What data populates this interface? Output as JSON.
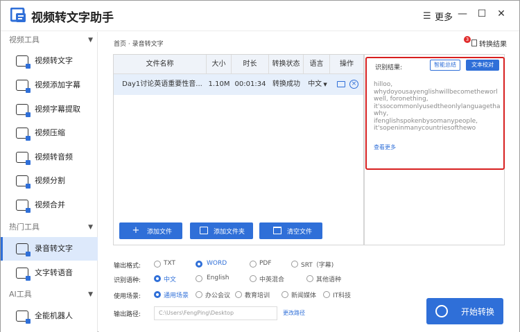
{
  "app": {
    "title": "视频转文字助手",
    "more_label": "更多",
    "menu_glyph": "☰",
    "minimize_glyph": "—",
    "maximize_glyph": "☐",
    "close_glyph": "✕"
  },
  "sidebar": {
    "sections": [
      {
        "label": "视频工具",
        "caret": "▼"
      },
      {
        "label": "热门工具",
        "caret": "▼"
      },
      {
        "label": "AI工具",
        "caret": "▼"
      }
    ],
    "video_tools": [
      {
        "label": "视频转文字",
        "icon": "video-to-text-icon"
      },
      {
        "label": "视频添加字幕",
        "icon": "add-subtitle-icon"
      },
      {
        "label": "视频字幕提取",
        "icon": "subtitle-extract-icon"
      },
      {
        "label": "视频压缩",
        "icon": "compress-icon"
      },
      {
        "label": "视频转音频",
        "icon": "video-to-audio-icon"
      },
      {
        "label": "视频分割",
        "icon": "split-icon"
      },
      {
        "label": "视频合并",
        "icon": "merge-icon"
      }
    ],
    "hot_tools": [
      {
        "label": "录音转文字",
        "icon": "audio-to-text-icon",
        "active": true
      },
      {
        "label": "文字转语音",
        "icon": "text-to-speech-icon"
      }
    ],
    "ai_tools": [
      {
        "label": "全能机器人",
        "icon": "robot-icon"
      }
    ]
  },
  "breadcrumb": "首页 · 录音转文字",
  "result_link": {
    "badge": "3",
    "label": "转换结果"
  },
  "table": {
    "headers": [
      "文件名称",
      "大小",
      "时长",
      "转换状态",
      "语言",
      "操作"
    ],
    "rows": [
      {
        "name": "Day1讨论英语重要性音...",
        "size": "1.10M",
        "duration": "00:01:34",
        "status": "转换成功",
        "language": "中文"
      }
    ]
  },
  "file_buttons": {
    "add_file": "添加文件",
    "add_folder": "添加文件夹",
    "clear": "清空文件"
  },
  "recognition": {
    "label": "识别结果:",
    "summary_button": "智能总结",
    "proof_button": "文本校对",
    "lines": [
      "hilloo,",
      "whydoyousayenglishwillbecometheworl",
      "well,  foronething,",
      "it'ssocommonlyusedtheonlylanguagetha",
      "why,",
      "ifenglishspokenbysomanypeople,",
      "it'sopeninmanycountriesofthewo"
    ],
    "see_more": "查看更多"
  },
  "options": {
    "format": {
      "label": "输出格式:",
      "choices": [
        "TXT",
        "WORD",
        "PDF",
        "SRT（字幕)"
      ],
      "selected": 1
    },
    "language": {
      "label": "识别语种:",
      "choices": [
        "中文",
        "English",
        "中英混合",
        "其他语种"
      ],
      "selected": 0
    },
    "scene": {
      "label": "使用场景:",
      "choices": [
        "通用场景",
        "办公会议",
        "教育培训",
        "新闻媒体",
        "IT科技"
      ],
      "selected": 0
    },
    "path": {
      "label": "输出路径:",
      "value": "C:\\Users\\FengPing\\Desktop",
      "change": "更改路径"
    }
  },
  "start_button": "开始转换",
  "colors": {
    "accent": "#2f6fd8",
    "highlight": "#d71f1f"
  }
}
